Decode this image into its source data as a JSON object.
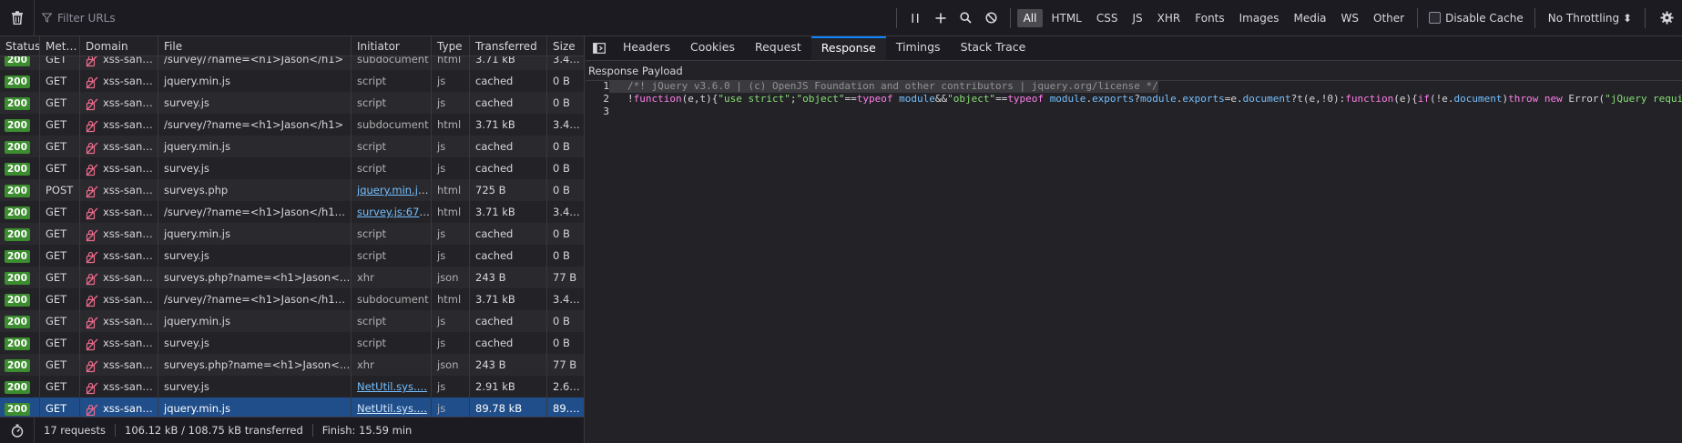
{
  "toolbar": {
    "filter_placeholder": "Filter URLs",
    "type_filters": [
      "All",
      "HTML",
      "CSS",
      "JS",
      "XHR",
      "Fonts",
      "Images",
      "Media",
      "WS",
      "Other"
    ],
    "active_filter": "All",
    "disable_cache_label": "Disable Cache",
    "throttling_label": "No Throttling ⬍"
  },
  "table": {
    "columns": [
      "Status",
      "Met…",
      "Domain",
      "File",
      "Initiator",
      "Type",
      "Transferred",
      "Size"
    ],
    "rows": [
      {
        "status": "200",
        "method": "GET",
        "domain": "xss-sand…",
        "file": "/survey/?name=<h1>Jason</h1>",
        "initiator": "subdocument",
        "initiator_link": false,
        "type": "html",
        "transferred": "3.71 kB",
        "size": "3.4…"
      },
      {
        "status": "200",
        "method": "GET",
        "domain": "xss-sand…",
        "file": "jquery.min.js",
        "initiator": "script",
        "initiator_link": false,
        "type": "js",
        "transferred": "cached",
        "size": "0 B"
      },
      {
        "status": "200",
        "method": "GET",
        "domain": "xss-sand…",
        "file": "survey.js",
        "initiator": "script",
        "initiator_link": false,
        "type": "js",
        "transferred": "cached",
        "size": "0 B"
      },
      {
        "status": "200",
        "method": "GET",
        "domain": "xss-sand…",
        "file": "/survey/?name=<h1>Jason</h1>",
        "initiator": "subdocument",
        "initiator_link": false,
        "type": "html",
        "transferred": "3.71 kB",
        "size": "3.4…"
      },
      {
        "status": "200",
        "method": "GET",
        "domain": "xss-sand…",
        "file": "jquery.min.js",
        "initiator": "script",
        "initiator_link": false,
        "type": "js",
        "transferred": "cached",
        "size": "0 B"
      },
      {
        "status": "200",
        "method": "GET",
        "domain": "xss-sand…",
        "file": "survey.js",
        "initiator": "script",
        "initiator_link": false,
        "type": "js",
        "transferred": "cached",
        "size": "0 B"
      },
      {
        "status": "200",
        "method": "POST",
        "domain": "xss-sand…",
        "file": "surveys.php",
        "initiator": "jquery.min.js:…",
        "initiator_link": true,
        "type": "html",
        "transferred": "725 B",
        "size": "0 B"
      },
      {
        "status": "200",
        "method": "GET",
        "domain": "xss-sand…",
        "file": "/survey/?name=<h1>Jason</h1>&result",
        "initiator": "survey.js:67 (…",
        "initiator_link": true,
        "type": "html",
        "transferred": "3.71 kB",
        "size": "3.4…"
      },
      {
        "status": "200",
        "method": "GET",
        "domain": "xss-sand…",
        "file": "jquery.min.js",
        "initiator": "script",
        "initiator_link": false,
        "type": "js",
        "transferred": "cached",
        "size": "0 B"
      },
      {
        "status": "200",
        "method": "GET",
        "domain": "xss-sand…",
        "file": "survey.js",
        "initiator": "script",
        "initiator_link": false,
        "type": "js",
        "transferred": "cached",
        "size": "0 B"
      },
      {
        "status": "200",
        "method": "GET",
        "domain": "xss-sand…",
        "file": "surveys.php?name=<h1>Jason</h1>",
        "initiator": "xhr",
        "initiator_link": false,
        "type": "json",
        "transferred": "243 B",
        "size": "77 B"
      },
      {
        "status": "200",
        "method": "GET",
        "domain": "xss-sand…",
        "file": "/survey/?name=<h1>Jason</h1>&result",
        "initiator": "subdocument",
        "initiator_link": false,
        "type": "html",
        "transferred": "3.71 kB",
        "size": "3.4…"
      },
      {
        "status": "200",
        "method": "GET",
        "domain": "xss-sand…",
        "file": "jquery.min.js",
        "initiator": "script",
        "initiator_link": false,
        "type": "js",
        "transferred": "cached",
        "size": "0 B"
      },
      {
        "status": "200",
        "method": "GET",
        "domain": "xss-sand…",
        "file": "survey.js",
        "initiator": "script",
        "initiator_link": false,
        "type": "js",
        "transferred": "cached",
        "size": "0 B"
      },
      {
        "status": "200",
        "method": "GET",
        "domain": "xss-sand…",
        "file": "surveys.php?name=<h1>Jason</h1>",
        "initiator": "xhr",
        "initiator_link": false,
        "type": "json",
        "transferred": "243 B",
        "size": "77 B"
      },
      {
        "status": "200",
        "method": "GET",
        "domain": "xss-sand…",
        "file": "survey.js",
        "initiator": "NetUtil.sys.…",
        "initiator_link": true,
        "type": "js",
        "transferred": "2.91 kB",
        "size": "2.64…"
      },
      {
        "status": "200",
        "method": "GET",
        "domain": "xss-sand…",
        "file": "jquery.min.js",
        "initiator": "NetUtil.sys.…",
        "initiator_link": true,
        "type": "js",
        "transferred": "89.78 kB",
        "size": "89.…",
        "selected": true
      }
    ]
  },
  "statusbar": {
    "requests": "17 requests",
    "transferred": "106.12 kB / 108.75 kB transferred",
    "finish": "Finish: 15.59 min"
  },
  "details": {
    "tabs": [
      "Headers",
      "Cookies",
      "Request",
      "Response",
      "Timings",
      "Stack Trace"
    ],
    "active_tab": "Response",
    "payload_title": "Response Payload",
    "code_lines": [
      {
        "n": "1",
        "text": "/*! jQuery v3.6.0 | (c) OpenJS Foundation and other contributors | jquery.org/license */"
      },
      {
        "n": "2",
        "text": "!function(e,t){\"use strict\";\"object\"==typeof module&&\"object\"==typeof module.exports?module.exports=e.document?t(e,!0):function(e){if(!e.document)throw new Error(\"jQuery requi"
      },
      {
        "n": "3",
        "text": ""
      }
    ]
  },
  "colors": {
    "status_ok": "#3c8d2f",
    "selected_row": "#204e8a",
    "active_tab_accent": "#0a84ff",
    "link": "#75bfff"
  }
}
